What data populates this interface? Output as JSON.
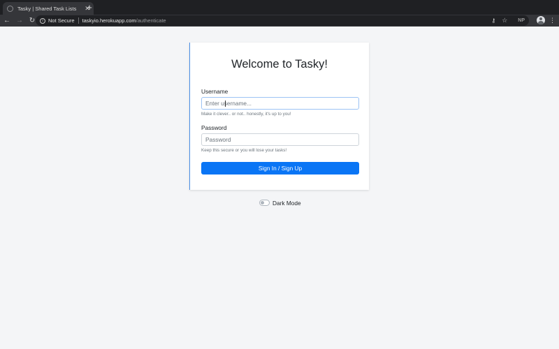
{
  "browser": {
    "tab": {
      "title": "Tasky | Shared Task Lists",
      "close": "✕"
    },
    "new_tab": "+",
    "nav": {
      "back": "←",
      "forward": "→",
      "reload": "↻"
    },
    "omnibox": {
      "security_icon": "i",
      "security_text": "Not Secure",
      "url_host": "taskyio.herokuapp.com",
      "url_path": "/authenticate"
    },
    "toolbar_icons": {
      "key": "⚷",
      "star": "☆",
      "extension": "NP",
      "menu": "⋮"
    }
  },
  "login": {
    "title": "Welcome to Tasky!",
    "username_label": "Username",
    "username_placeholder": "Enter username...",
    "username_value": "",
    "username_help": "Make it clever.. or not.. honestly, it's up to you!",
    "password_label": "Password",
    "password_placeholder": "Password",
    "password_help": "Keep this secure or you will lose your tasks!",
    "submit_label": "Sign In / Sign Up"
  },
  "dark_mode": {
    "label": "Dark Mode",
    "enabled": false
  },
  "colors": {
    "accent": "#0a75f5",
    "card_border_accent": "#4a8fe6",
    "page_background": "#f4f5f7"
  }
}
